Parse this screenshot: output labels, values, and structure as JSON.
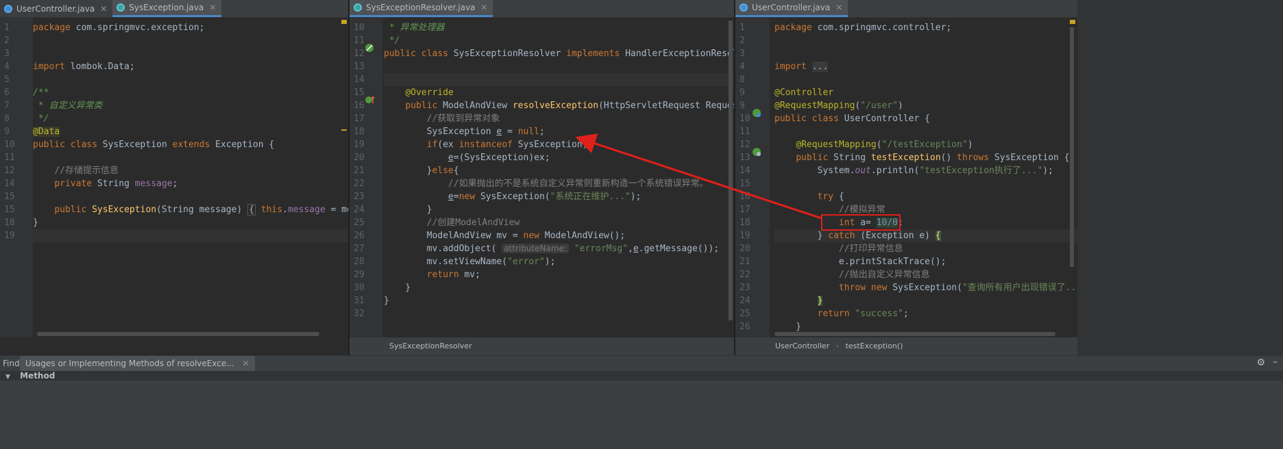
{
  "pane1": {
    "tabs": [
      {
        "label": "UserController.java",
        "icon": "class-icon",
        "active": false
      },
      {
        "label": "SysException.java",
        "icon": "class-icon",
        "active": true
      }
    ],
    "lines": [
      {
        "n": "1",
        "h": "<span class=\"kw\">package</span> com.springmvc.exception;"
      },
      {
        "n": "2",
        "h": ""
      },
      {
        "n": "3",
        "h": ""
      },
      {
        "n": "4",
        "h": "<span class=\"kw\">import</span> lombok.Data;"
      },
      {
        "n": "5",
        "h": ""
      },
      {
        "n": "6",
        "h": "<span class=\"doc\">/**</span>"
      },
      {
        "n": "7",
        "h": "<span class=\"doc\"> * 自定义异常类</span>"
      },
      {
        "n": "8",
        "h": "<span class=\"doc\"> */</span>"
      },
      {
        "n": "9",
        "h": "<span class=\"an\" style=\"background:#3b3b2b\">@Data</span>"
      },
      {
        "n": "10",
        "h": "<span class=\"kw\">public class</span> SysException <span class=\"kw\">extends</span> Exception {"
      },
      {
        "n": "11",
        "h": ""
      },
      {
        "n": "12",
        "h": "    <span class=\"cm\">//存储提示信息</span>"
      },
      {
        "n": "14",
        "h": "    <span class=\"kw\">private</span> String <span class=\"fld\">message</span>;"
      },
      {
        "n": "15",
        "h": ""
      },
      {
        "n": "15",
        "h": "    <span class=\"kw\">public</span> <span class=\"fn\">SysException</span>(String message) <span class=\"fold\">{</span> <span class=\"kw\">this</span>.<span class=\"fld\">message</span> = message; <span class=\"fold\">}</span>"
      },
      {
        "n": "18",
        "h": "}"
      },
      {
        "n": "19",
        "h": "",
        "cur": true
      }
    ]
  },
  "pane2": {
    "tabs": [
      {
        "label": "SysExceptionResolver.java",
        "icon": "class-icon",
        "active": true
      }
    ],
    "breadcrumb": "SysExceptionResolver",
    "lines": [
      {
        "n": "10",
        "h": "<span class=\"doc\"> * 异常处理器</span>"
      },
      {
        "n": "11",
        "h": "<span class=\"doc\"> */</span>"
      },
      {
        "n": "12",
        "h": "<span class=\"kw\">public class</span> SysExceptionResolver <span class=\"kw\">implements</span> HandlerExceptionResolver {"
      },
      {
        "n": "13",
        "h": ""
      },
      {
        "n": "14",
        "h": "",
        "cur": true
      },
      {
        "n": "15",
        "h": "    <span class=\"an\">@Override</span>"
      },
      {
        "n": "16",
        "h": "    <span class=\"kw\">public</span> ModelAndView <span class=\"fn\">resolveException</span>(HttpServletRequest Request, HttpServ"
      },
      {
        "n": "17",
        "h": "        <span class=\"cm\">//获取到异常对象</span>"
      },
      {
        "n": "18",
        "h": "        SysException <span class=\"und\">e</span> = <span class=\"kw\">null</span>;"
      },
      {
        "n": "19",
        "h": "        <span class=\"kw\">if</span>(ex <span class=\"kw\">instanceof</span> SysException){"
      },
      {
        "n": "20",
        "h": "            <span class=\"und\">e</span>=(SysException)ex;"
      },
      {
        "n": "21",
        "h": "        }<span class=\"kw\">else</span>{"
      },
      {
        "n": "22",
        "h": "            <span class=\"cm\">//如果抛出的不是系统自定义异常则重新构造一个系统错误异常。</span>"
      },
      {
        "n": "23",
        "h": "            <span class=\"und\">e</span>=<span class=\"kw\">new</span> SysException(<span class=\"st\">\"系统正在维护...\"</span>);"
      },
      {
        "n": "24",
        "h": "        }"
      },
      {
        "n": "25",
        "h": "        <span class=\"cm\">//创建ModelAndView</span>"
      },
      {
        "n": "26",
        "h": "        ModelAndView mv = <span class=\"kw\">new</span> ModelAndView();"
      },
      {
        "n": "27",
        "h": "        mv.addObject( <span class=\"hint\">attributeName:</span> <span class=\"st\">\"errorMsg\"</span>,<span class=\"und\">e</span>.getMessage());"
      },
      {
        "n": "28",
        "h": "        mv.setViewName(<span class=\"st\">\"error\"</span>);"
      },
      {
        "n": "29",
        "h": "        <span class=\"kw\">return</span> mv;"
      },
      {
        "n": "30",
        "h": "    }"
      },
      {
        "n": "31",
        "h": "}"
      },
      {
        "n": "32",
        "h": ""
      }
    ]
  },
  "pane3": {
    "tabs": [
      {
        "label": "UserController.java",
        "icon": "class-icon",
        "active": true
      }
    ],
    "breadcrumb": [
      "UserController",
      "testException()"
    ],
    "lines": [
      {
        "n": "1",
        "h": "<span class=\"kw\">package</span> com.springmvc.controller;"
      },
      {
        "n": "2",
        "h": ""
      },
      {
        "n": "3",
        "h": ""
      },
      {
        "n": "4",
        "h": "<span class=\"kw\">import</span> <span style=\"background:#3b3b3b\">...</span>"
      },
      {
        "n": "8",
        "h": ""
      },
      {
        "n": "9",
        "h": "<span class=\"an\">@Controller</span>"
      },
      {
        "n": "9",
        "h": "<span class=\"an\">@RequestMapping</span>(<span class=\"st\">\"/user\"</span>)"
      },
      {
        "n": "10",
        "h": "<span class=\"kw\">public class</span> UserController {"
      },
      {
        "n": "11",
        "h": ""
      },
      {
        "n": "12",
        "h": "    <span class=\"an\">@RequestMapping</span>(<span class=\"st\">\"/testException\"</span>)"
      },
      {
        "n": "13",
        "h": "    <span class=\"kw\">public</span> String <span class=\"fn\">testException</span>() <span class=\"kw\">throws</span> SysException {"
      },
      {
        "n": "14",
        "h": "        System.<span class=\"it\">out</span>.println(<span class=\"st\">\"testException执行了...\"</span>);"
      },
      {
        "n": "15",
        "h": ""
      },
      {
        "n": "16",
        "h": "        <span class=\"kw\">try</span> {"
      },
      {
        "n": "17",
        "h": "            <span class=\"cm\">//模拟异常</span>"
      },
      {
        "n": "18",
        "h": "            <span class=\"kw\">int</span> a= <span class=\"num\" style=\"background:#344134\">10/0</span>;"
      },
      {
        "n": "19",
        "h": "        } <span class=\"kw\">catch</span> (Exception e) <span style=\"color:#ffef28;background:#3b514d\">{</span>",
        "cur": true
      },
      {
        "n": "20",
        "h": "            <span class=\"cm\">//打印异常信息</span>"
      },
      {
        "n": "21",
        "h": "            e.printStackTrace();"
      },
      {
        "n": "22",
        "h": "            <span class=\"cm\">//抛出自定义异常信息</span>"
      },
      {
        "n": "23",
        "h": "            <span class=\"kw\">throw new</span> SysException(<span class=\"st\">\"查询所有用户出现错误了...\"</span>);"
      },
      {
        "n": "24",
        "h": "        <span style=\"color:#ffef28;background:#3b514d\">}</span>"
      },
      {
        "n": "25",
        "h": "        <span class=\"kw\">return</span> <span class=\"st\">\"success\"</span>;"
      },
      {
        "n": "26",
        "h": "    }"
      }
    ]
  },
  "find": {
    "label": "Find:",
    "tab_label": "Usages or Implementing Methods of resolveExce...",
    "tree_header": "Method"
  },
  "colors": {
    "accent": "#4a88c7",
    "annotation_arrow": "#e0201a"
  }
}
